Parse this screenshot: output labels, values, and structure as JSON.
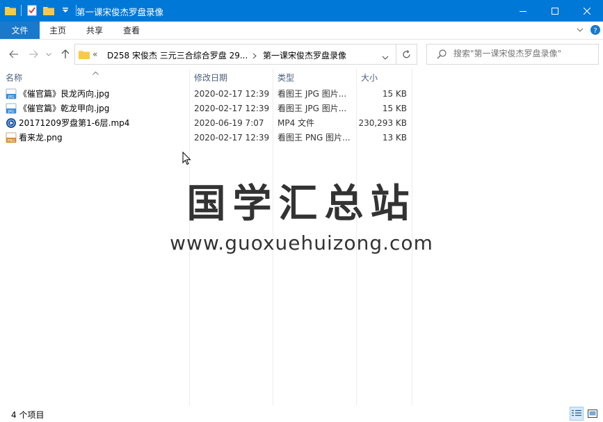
{
  "window": {
    "title": "第一课宋俊杰罗盘录像"
  },
  "ribbon": {
    "file_tab": "文件",
    "tabs": [
      "主页",
      "共享",
      "查看"
    ]
  },
  "address": {
    "overflow": "«",
    "crumbs": [
      "D258 宋俊杰 三元三合综合罗盘 29...",
      "第一课宋俊杰罗盘录像"
    ]
  },
  "search": {
    "placeholder": "搜索\"第一课宋俊杰罗盘录像\""
  },
  "columns": {
    "name": "名称",
    "modified": "修改日期",
    "type": "类型",
    "size": "大小"
  },
  "files": [
    {
      "name": "《催官篇》艮龙丙向.jpg",
      "modified": "2020-02-17 12:39",
      "type": "看图王 JPG 图片...",
      "size": "15 KB",
      "icon": "jpg-file-icon"
    },
    {
      "name": "《催官篇》乾龙甲向.jpg",
      "modified": "2020-02-17 12:39",
      "type": "看图王 JPG 图片...",
      "size": "15 KB",
      "icon": "jpg-file-icon"
    },
    {
      "name": "20171209罗盘第1-6层.mp4",
      "modified": "2020-06-19 7:07",
      "type": "MP4 文件",
      "size": "230,293 KB",
      "icon": "mp4-file-icon"
    },
    {
      "name": "看来龙.png",
      "modified": "2020-02-17 12:39",
      "type": "看图王 PNG 图片...",
      "size": "13 KB",
      "icon": "png-file-icon"
    }
  ],
  "status": {
    "item_count": "4 个项目"
  },
  "watermark": {
    "title": "国学汇总站",
    "url": "www.guoxuehuizong.com"
  },
  "colors": {
    "titlebar": "#0078d7",
    "file_tab": "#1979ca",
    "header_text": "#4c607a"
  }
}
